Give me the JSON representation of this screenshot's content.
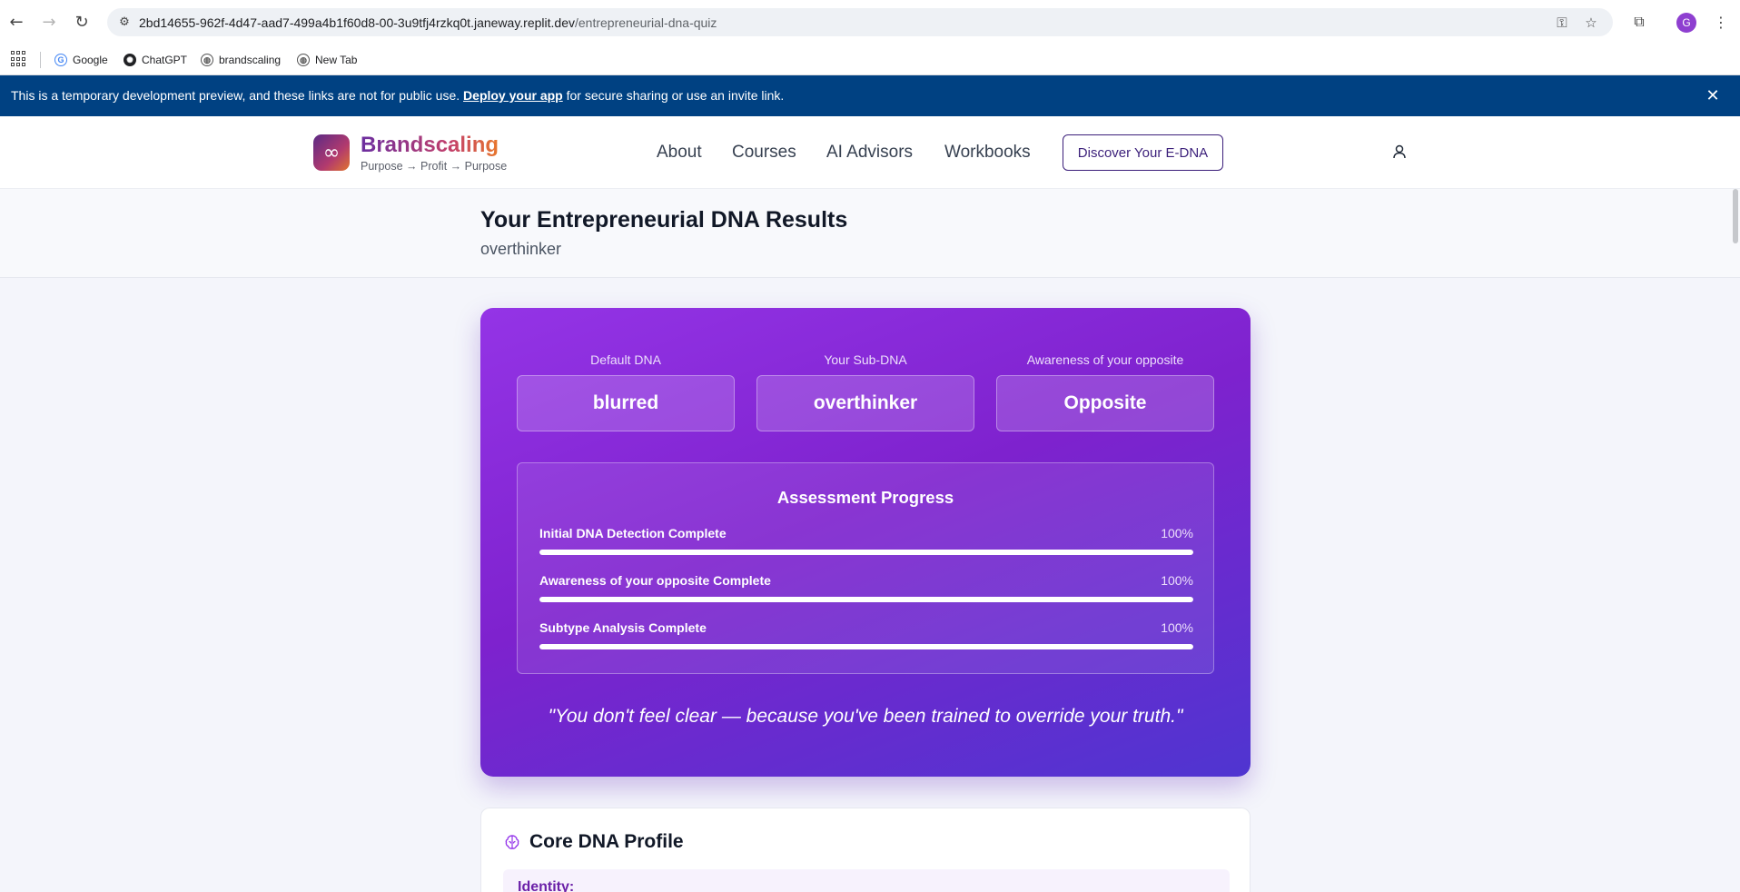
{
  "browser": {
    "url_host": "2bd14655-962f-4d47-aad7-499a4b1f60d8-00-3u9tfj4rzkq0t.janeway.replit.dev",
    "url_path": "/entrepreneurial-dna-quiz",
    "profile_initial": "G",
    "bookmarks": [
      {
        "label": "Google",
        "icon": "google-icon"
      },
      {
        "label": "ChatGPT",
        "icon": "chatgpt-icon"
      },
      {
        "label": "brandscaling",
        "icon": "globe-icon"
      },
      {
        "label": "New Tab",
        "icon": "globe-icon"
      }
    ]
  },
  "dev_banner": {
    "text_before": "This is a temporary development preview, and these links are not for public use.",
    "link_text": "Deploy your app",
    "text_after": "for secure sharing or use an invite link."
  },
  "site": {
    "brand_name": "Brandscaling",
    "tagline": "Purpose → Profit → Purpose",
    "nav": [
      "About",
      "Courses",
      "AI Advisors",
      "Workbooks"
    ],
    "cta_label": "Discover Your E-DNA"
  },
  "page": {
    "title": "Your Entrepreneurial DNA Results",
    "subtitle": "overthinker"
  },
  "results": {
    "columns": [
      {
        "label": "Default DNA",
        "value": "blurred"
      },
      {
        "label": "Your Sub-DNA",
        "value": "overthinker"
      },
      {
        "label": "Awareness of your opposite",
        "value": "Opposite"
      }
    ],
    "progress_title": "Assessment Progress",
    "progress": [
      {
        "label": "Initial DNA Detection Complete",
        "percent_text": "100%",
        "percent": 100
      },
      {
        "label": "Awareness of your opposite Complete",
        "percent_text": "100%",
        "percent": 100
      },
      {
        "label": "Subtype Analysis Complete",
        "percent_text": "100%",
        "percent": 100
      }
    ],
    "quote": "\"You don't feel clear — because you've been trained to override your truth.\""
  },
  "profile": {
    "title": "Core DNA Profile",
    "first_section": "Identity:"
  },
  "colors": {
    "banner": "#004182",
    "card_gradient_start": "#9434e6",
    "card_gradient_end": "#4f35d0",
    "brand_purple": "#6b2ea0",
    "brand_orange": "#e8772c"
  }
}
